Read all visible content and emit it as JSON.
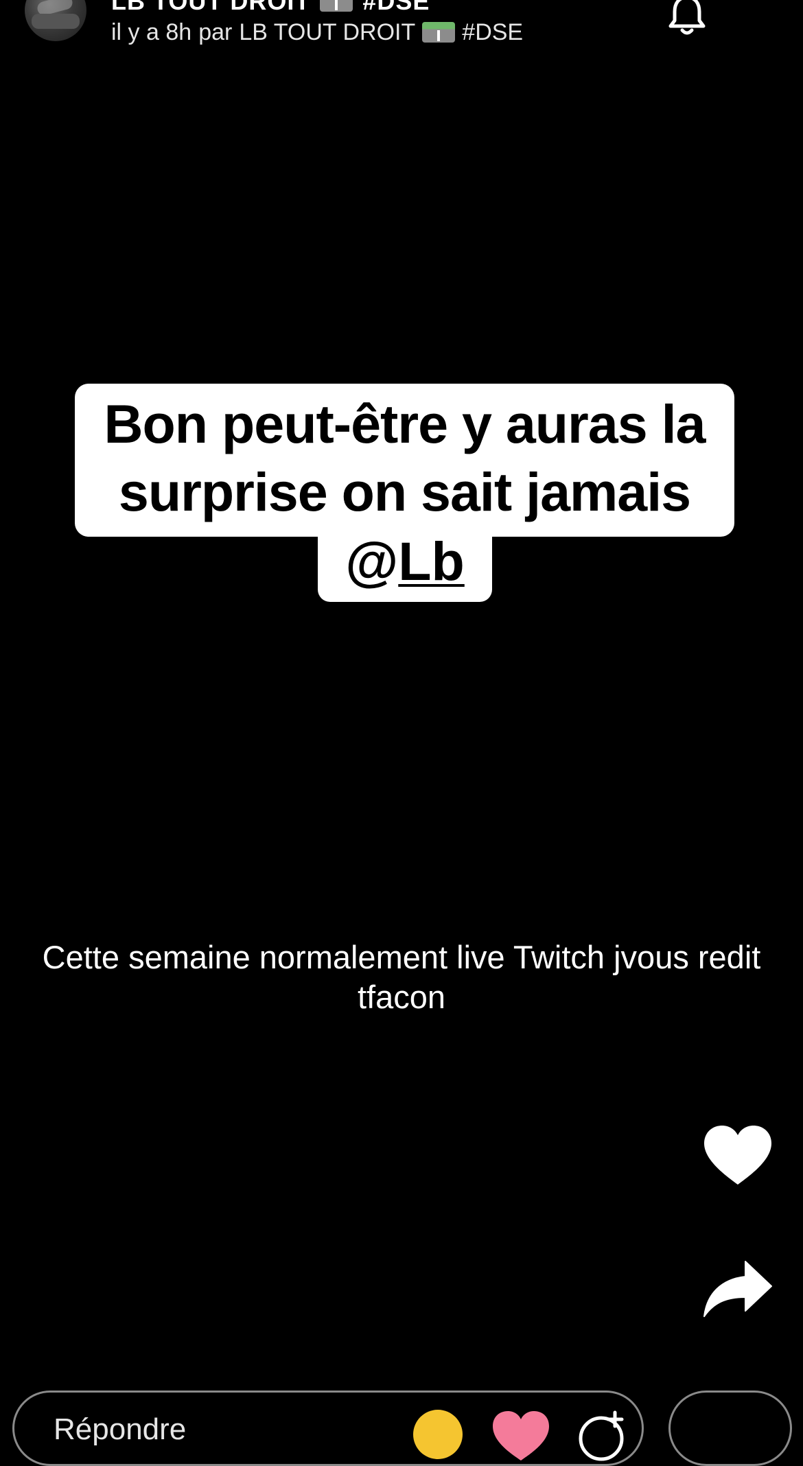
{
  "header": {
    "channel_name": "LB TOUT DROIT",
    "channel_tag": "#DSE",
    "channel_emoji": "motorway-emoji",
    "time_ago": "il y a 8h",
    "by_label": "par",
    "author": "LB TOUT DROIT",
    "author_tag": "#DSE",
    "notification_icon": "bell-icon"
  },
  "story": {
    "caption_text": "Bon peut-être y auras la surprise on sait jamais",
    "mention_at": "@",
    "mention_handle": "Lb",
    "description": "Cette semaine normalement live Twitch jvous redit tfacon"
  },
  "actions": {
    "like_icon": "heart-icon",
    "share_icon": "share-arrow-icon"
  },
  "reply_bar": {
    "placeholder": "Répondre",
    "quick_reactions": [
      "sad-face-emoji",
      "heart-emoji",
      "add-reaction-icon"
    ]
  },
  "colors": {
    "background": "#000000",
    "sticker_bg": "#ffffff",
    "heart_emoji": "#f47b9a",
    "sad_emoji": "#f5c530"
  }
}
